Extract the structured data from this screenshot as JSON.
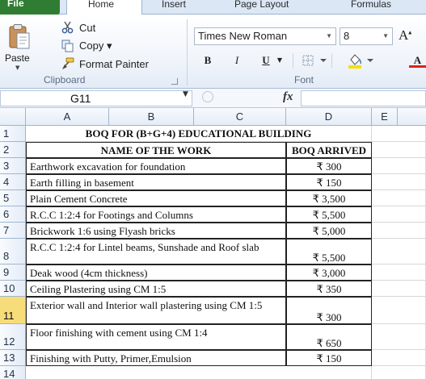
{
  "tabs": [
    "File",
    "Home",
    "Insert",
    "Page Layout",
    "Formulas"
  ],
  "clipboard": {
    "paste_label": "Paste",
    "cut_label": "Cut",
    "copy_label": "Copy ▾",
    "format_painter_label": "Format Painter",
    "group_label": "Clipboard"
  },
  "font": {
    "family": "Times New Roman",
    "size": "8",
    "bold": "B",
    "italic": "I",
    "underline": "U",
    "group_label": "Font"
  },
  "formula_bar": {
    "name_box": "G11",
    "fx": "fx",
    "formula": ""
  },
  "columns": [
    "A",
    "B",
    "C",
    "D",
    "E"
  ],
  "rows": [
    {
      "num": "1",
      "work": "BOQ FOR (B+G+4) EDUCATIONAL BUILDING",
      "amount": "",
      "kind": "title"
    },
    {
      "num": "2",
      "work": "NAME OF THE WORK",
      "amount": "BOQ ARRIVED",
      "kind": "header"
    },
    {
      "num": "3",
      "work": "Earthwork excavation for foundation",
      "amount": "₹ 300",
      "kind": "data"
    },
    {
      "num": "4",
      "work": "Earth filling in basement",
      "amount": "₹ 150",
      "kind": "data"
    },
    {
      "num": "5",
      "work": "Plain Cement Concrete",
      "amount": "₹ 3,500",
      "kind": "data"
    },
    {
      "num": "6",
      "work": "R.C.C 1:2:4 for Footings and Columns",
      "amount": "₹ 5,500",
      "kind": "data"
    },
    {
      "num": "7",
      "work": "Brickwork 1:6 using Flyash bricks",
      "amount": "₹ 5,000",
      "kind": "data"
    },
    {
      "num": "8",
      "work": "R.C.C 1:2:4 for Lintel beams, Sunshade and Roof slab",
      "amount": "₹ 5,500",
      "kind": "data"
    },
    {
      "num": "9",
      "work": "Deak wood (4cm thickness)",
      "amount": "₹ 3,000",
      "kind": "data"
    },
    {
      "num": "10",
      "work": "Ceiling Plastering using CM 1:5",
      "amount": "₹ 350",
      "kind": "data"
    },
    {
      "num": "11",
      "work": "Exterior wall and Interior wall plastering using CM 1:5",
      "amount": "₹ 300",
      "kind": "data"
    },
    {
      "num": "12",
      "work": "Floor finishing with cement using CM 1:4",
      "amount": "₹ 650",
      "kind": "data"
    },
    {
      "num": "13",
      "work": "Finishing with Putty, Primer,Emulsion",
      "amount": "₹ 150",
      "kind": "data"
    },
    {
      "num": "14",
      "work": "",
      "amount": "",
      "kind": "empty"
    }
  ],
  "colors": {
    "file_tab": "#2f7d32",
    "active_row_header": "#f7dd7a",
    "grid_line": "#d7d7d7"
  }
}
